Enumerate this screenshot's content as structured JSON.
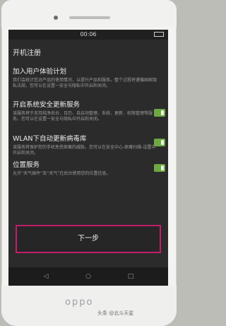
{
  "status": {
    "time": "00:06"
  },
  "page": {
    "title": "开机注册"
  },
  "sections": [
    {
      "title": "加入用户体验计划",
      "desc": "我们会统计您对产品的使用情况，以提升产品和服务。整个过程将遵循国家隐私法规，您可以在设置一安全与隐私中开启和关闭。"
    },
    {
      "title": "开启系统安全更新服务",
      "desc": "该服务将于支持纯净后台、日历、自启动管理、系统、更新、权限管理等服务。您可以在设置一安全与隐私中开启和关闭。"
    },
    {
      "title": "WLAN下自动更新病毒库",
      "desc": "该服务将保护您的手机免受病毒的威胁。您可以在安全中心-病毒扫描-设置中开启和关闭。"
    },
    {
      "title": "位置服务",
      "desc": "允许“天气插件”及“天气”在后台使用您的位置信息。"
    }
  ],
  "next_button": {
    "label": "下一步"
  },
  "brand": {
    "text": "oppo"
  },
  "watermark": {
    "text": "头条 @北斗天星"
  }
}
